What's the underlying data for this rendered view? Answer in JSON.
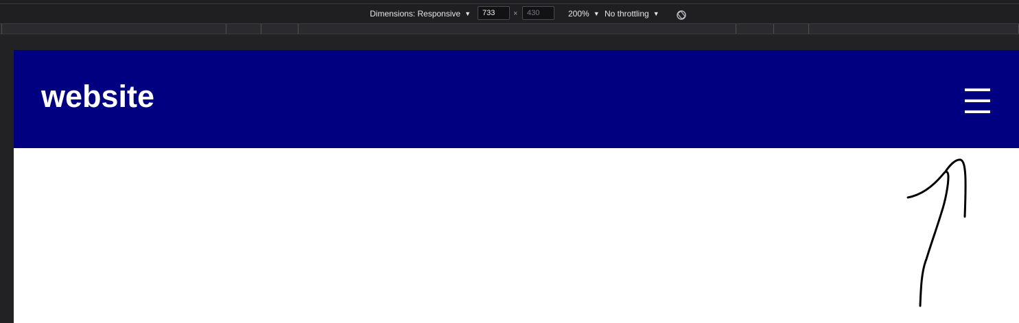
{
  "devtools": {
    "dimensions_label": "Dimensions: Responsive",
    "width_value": "733",
    "height_placeholder": "430",
    "times_symbol": "×",
    "zoom_label": "200%",
    "throttling_label": "No throttling",
    "caret": "▼",
    "rotate_icon": "rotate-icon"
  },
  "site": {
    "logo_text": "website",
    "menu_icon": "hamburger-menu-icon",
    "header_color": "#000080"
  },
  "annotation": {
    "type": "hand-drawn-arrow",
    "points_to": "hamburger-menu"
  }
}
